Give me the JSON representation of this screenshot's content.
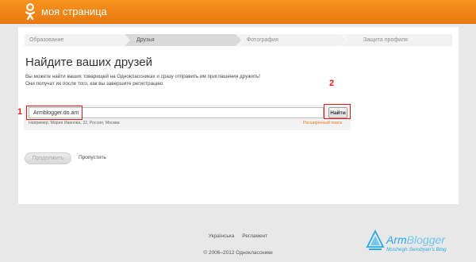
{
  "header": {
    "title": "моя страница"
  },
  "steps": [
    {
      "label": "Образование",
      "state": "done"
    },
    {
      "label": "Друзья",
      "state": "active"
    },
    {
      "label": "Фотография",
      "state": "pending"
    },
    {
      "label": "Защита профиля",
      "state": "pending"
    }
  ],
  "main": {
    "title": "Найдите ваших друзей",
    "desc_line1": "Вы можете найти ваших товарищей на Одноклассниках и сразу отправить им приглашения дружить!",
    "desc_line2": "Они получат их после того, как вы завершите регистрацию."
  },
  "search": {
    "value": "Armblogger.do.am",
    "button": "Найти",
    "hint": "Например, Мария Иванова, 32, Россия, Москва",
    "advanced": "Расширенный поиск"
  },
  "annotations": {
    "one": "1",
    "two": "2"
  },
  "actions": {
    "continue": "Продолжить",
    "skip": "Пропустить"
  },
  "footer": {
    "lang": "Українська",
    "rules": "Регламент",
    "copyright": "© 2006–2012 Одноклассники"
  },
  "watermark": {
    "title_a": "Arm",
    "title_b": "Blogger",
    "subtitle": "Mushegh Serobyan's Blog"
  },
  "colors": {
    "brand": "#f7931e",
    "annotation": "#e01818",
    "watermark": "#29a9e6"
  }
}
